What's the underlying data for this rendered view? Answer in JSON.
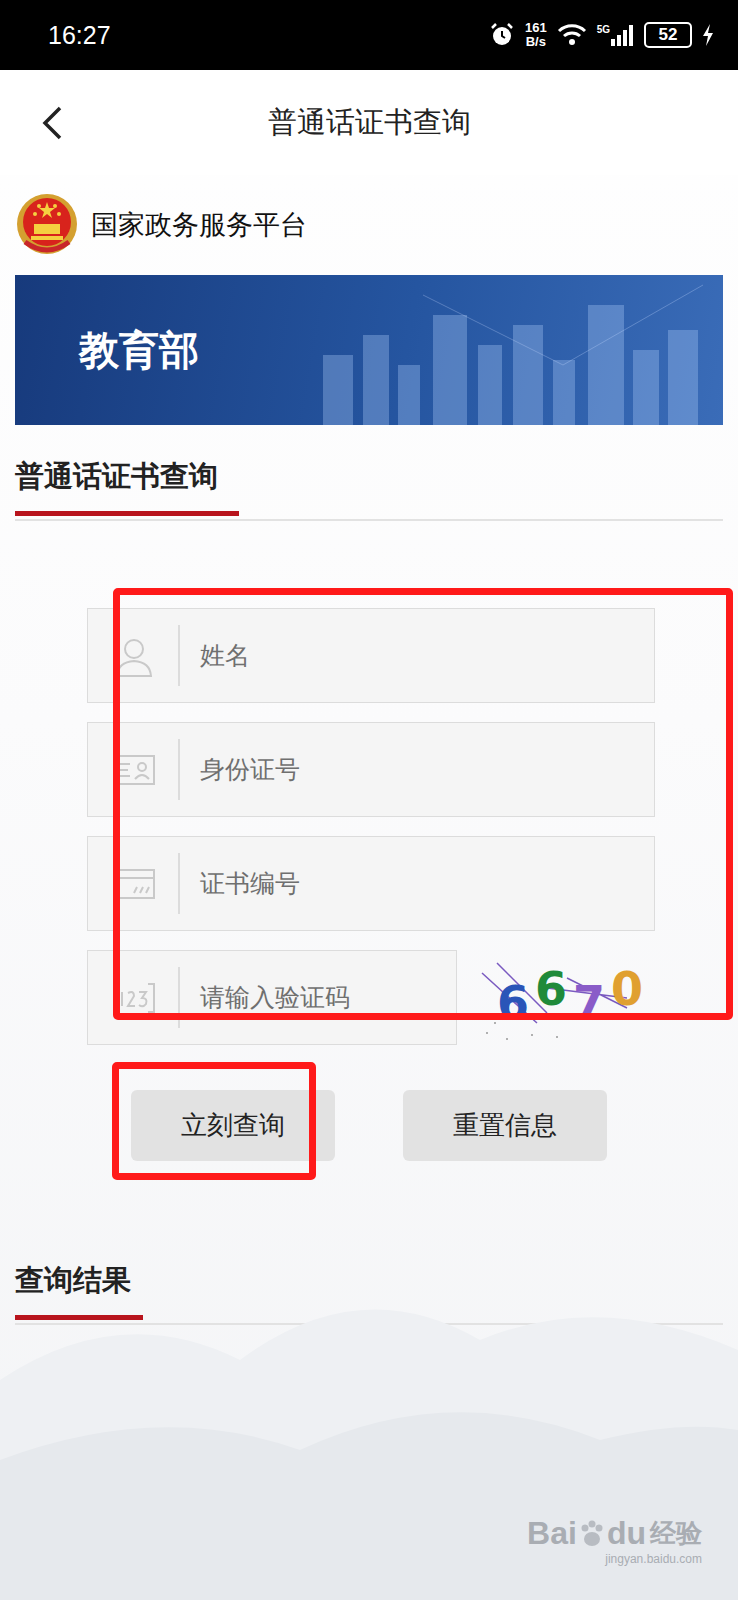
{
  "status_bar": {
    "time": "16:27",
    "speed_value": "161",
    "speed_unit": "B/s",
    "network": "5G",
    "battery": "52",
    "charging": true
  },
  "header": {
    "title": "普通话证书查询"
  },
  "platform": {
    "name": "国家政务服务平台"
  },
  "banner": {
    "title": "教育部"
  },
  "form": {
    "title": "普通话证书查询",
    "annotated": true,
    "fields": [
      {
        "placeholder": "姓名",
        "kind": "name"
      },
      {
        "placeholder": "身份证号",
        "kind": "id"
      },
      {
        "placeholder": "证书编号",
        "kind": "cert"
      },
      {
        "placeholder": "请输入验证码",
        "kind": "captcha"
      }
    ],
    "captcha": "6670",
    "buttons": [
      {
        "label": "立刻查询",
        "annotated": true
      },
      {
        "label": "重置信息",
        "annotated": false
      }
    ]
  },
  "results": {
    "title": "查询结果"
  },
  "watermark": {
    "left": "Bai",
    "right": "du",
    "label": "经验",
    "url": "jingyan.baidu.com"
  }
}
